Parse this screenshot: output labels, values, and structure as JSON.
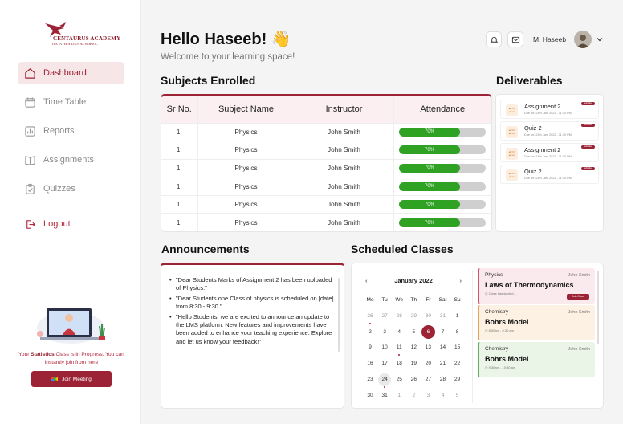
{
  "app": {
    "logo_text": "CENTAURUS ACADEMY",
    "logo_subtext": "THE INTERNATIONAL SCHOOL"
  },
  "sidebar": {
    "items": [
      {
        "label": "Dashboard",
        "icon": "home-icon",
        "active": true
      },
      {
        "label": "Time Table",
        "icon": "calendar-icon"
      },
      {
        "label": "Reports",
        "icon": "chart-icon"
      },
      {
        "label": "Assignments",
        "icon": "book-icon"
      },
      {
        "label": "Quizzes",
        "icon": "clipboard-icon"
      }
    ],
    "logout_label": "Logout",
    "promo_prefix": "Your ",
    "promo_bold": "Statistics",
    "promo_suffix": " Class is in Progress. You can instantly join from here",
    "join_label": "Join Meeting"
  },
  "header": {
    "greeting": "Hello Haseeb! 👋",
    "subtitle": "Welcome to your learning space!",
    "user_name": "M. Haseeb"
  },
  "subjects": {
    "title": "Subjects Enrolled",
    "columns": [
      "Sr No.",
      "Subject Name",
      "Instructor",
      "Attendance"
    ],
    "rows": [
      {
        "sr": "1.",
        "subject": "Physics",
        "instructor": "John Smith",
        "attendance": 70,
        "attendance_label": "70%"
      },
      {
        "sr": "1.",
        "subject": "Physics",
        "instructor": "John Smith",
        "attendance": 70,
        "attendance_label": "70%"
      },
      {
        "sr": "1.",
        "subject": "Physics",
        "instructor": "John Smith",
        "attendance": 70,
        "attendance_label": "70%"
      },
      {
        "sr": "1.",
        "subject": "Physics",
        "instructor": "John Smith",
        "attendance": 70,
        "attendance_label": "70%"
      },
      {
        "sr": "1.",
        "subject": "Physics",
        "instructor": "John Smith",
        "attendance": 70,
        "attendance_label": "70%"
      },
      {
        "sr": "1.",
        "subject": "Physics",
        "instructor": "John Smith",
        "attendance": 70,
        "attendance_label": "70%"
      }
    ]
  },
  "deliverables": {
    "title": "Deliverables",
    "items": [
      {
        "title": "Assignment 2",
        "due": "Due on: 24th Jan, 2022 - 11:30 PM",
        "badge": "Submitted"
      },
      {
        "title": "Quiz 2",
        "due": "Due on: 24th Jan, 2022 - 11:30 PM",
        "badge": "Submitted"
      },
      {
        "title": "Assignment 2",
        "due": "Due on: 24th Jan, 2022 - 11:30 PM",
        "badge": "Submitted"
      },
      {
        "title": "Quiz 2",
        "due": "Due on: 24th Jan, 2022 - 11:30 PM",
        "badge": "Submitted"
      }
    ]
  },
  "announcements": {
    "title": "Announcements",
    "items": [
      "\"Dear Students Marks of Assignment 2 has been uploaded of Physics.\"",
      "\"Dear Students one Class of physics is scheduled on [date] from 8:30 - 9:30.\"",
      "\"Hello Students, we are excited to announce an update to the LMS platform. New features and improvements have been added to enhance your teaching experience. Explore and let us know your feedback!\""
    ]
  },
  "scheduled": {
    "title": "Scheduled Classes",
    "calendar": {
      "month": "January 2022",
      "weekdays": [
        "Mo",
        "Tu",
        "We",
        "Th",
        "Fr",
        "Sat",
        "Su"
      ],
      "weeks": [
        [
          "26",
          "27",
          "28",
          "29",
          "30",
          "31",
          "1"
        ],
        [
          "2",
          "3",
          "4",
          "5",
          "6",
          "7",
          "8"
        ],
        [
          "9",
          "10",
          "11",
          "12",
          "13",
          "14",
          "15"
        ],
        [
          "16",
          "17",
          "18",
          "19",
          "20",
          "21",
          "22"
        ],
        [
          "23",
          "24",
          "25",
          "26",
          "27",
          "28",
          "29"
        ],
        [
          "30",
          "31",
          "1",
          "2",
          "3",
          "4",
          "5"
        ]
      ]
    },
    "classes": [
      {
        "subject": "Physics",
        "instructor": "John Smith",
        "topic": "Laws of Thermodynamics",
        "meta": "Class has started...",
        "join": "Join Class",
        "color": "#d9546b",
        "bg": "#fbeaed"
      },
      {
        "subject": "Chemistry",
        "instructor": "John Smith",
        "topic": "Bohrs Model",
        "meta": "8:00am - 9:30 am",
        "color": "#e8a05a",
        "bg": "#fdf1e4"
      },
      {
        "subject": "Chemistry",
        "instructor": "John Smith",
        "topic": "Bohrs Model",
        "meta": "9:30am - 10:30 am",
        "color": "#5fae62",
        "bg": "#eaf5e8"
      }
    ]
  },
  "colors": {
    "accent": "#9b2335",
    "progress": "#2fa224"
  }
}
